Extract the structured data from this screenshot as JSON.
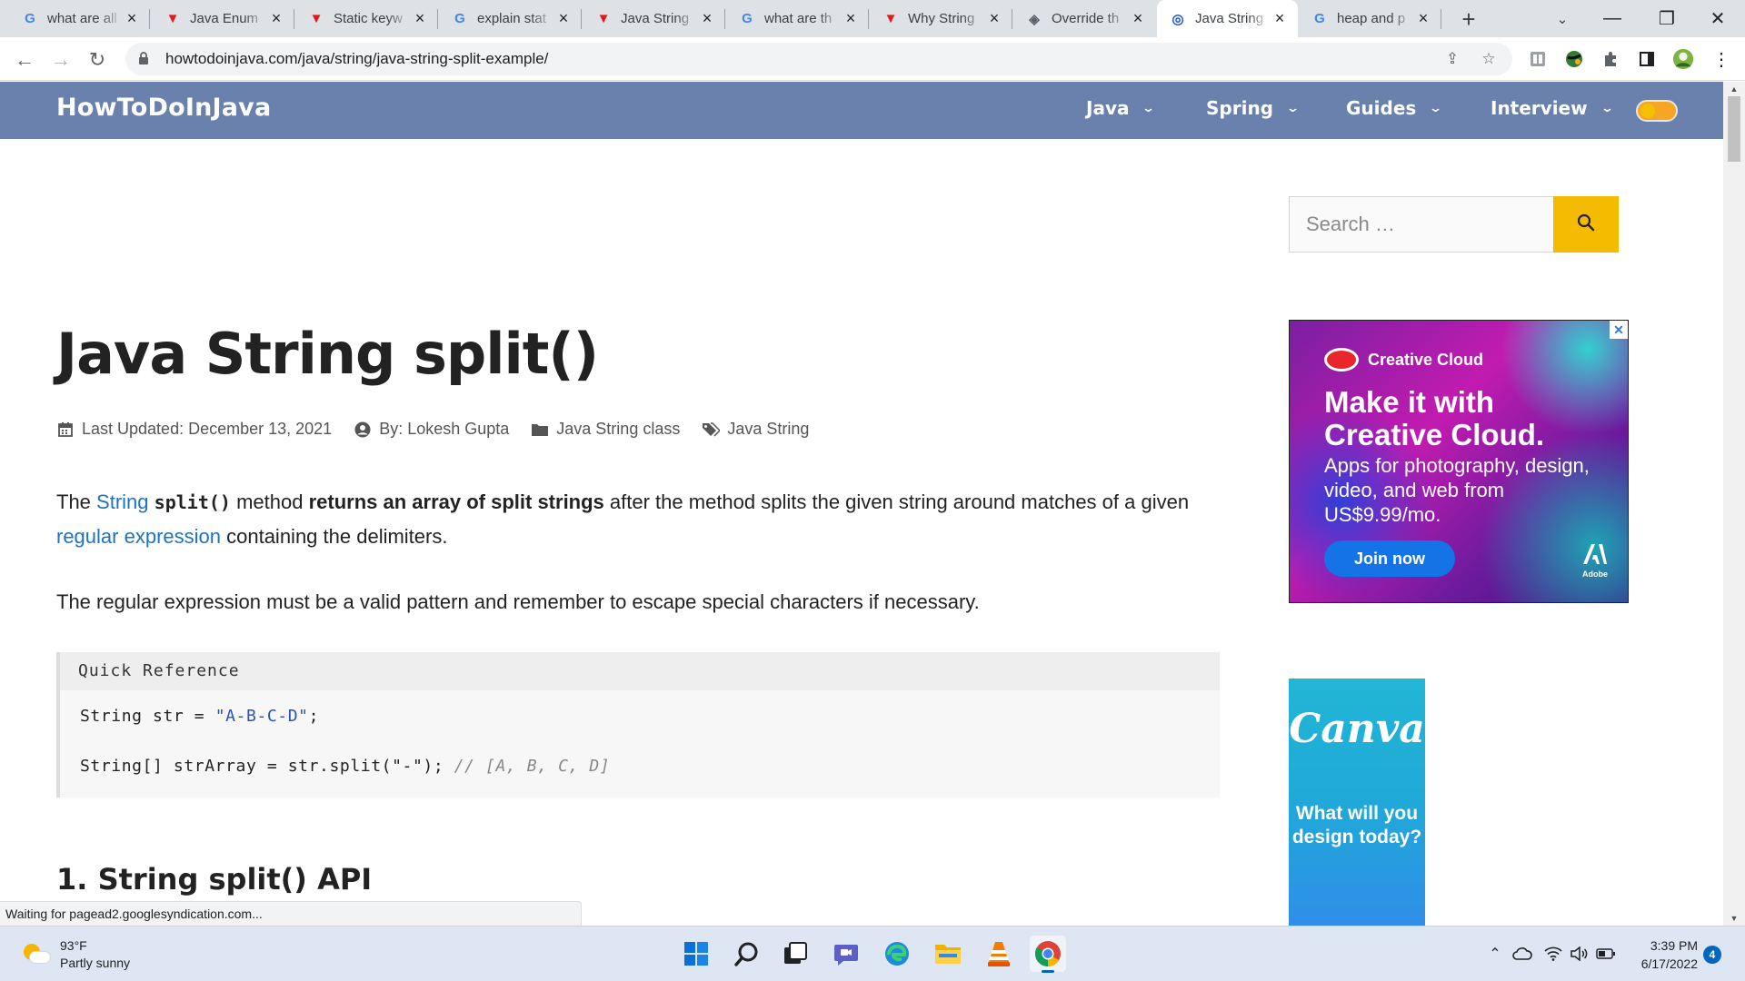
{
  "browser": {
    "tabs": [
      {
        "label": "what are all",
        "favicon": "google-icon",
        "active": false
      },
      {
        "label": "Java Enum",
        "favicon": "vivaldi-v-icon",
        "active": false
      },
      {
        "label": "Static keyw",
        "favicon": "vivaldi-v-icon",
        "active": false
      },
      {
        "label": "explain stat",
        "favicon": "google-icon",
        "active": false
      },
      {
        "label": "Java String",
        "favicon": "vivaldi-v-icon",
        "active": false
      },
      {
        "label": "what are th",
        "favicon": "google-icon",
        "active": false
      },
      {
        "label": "Why String",
        "favicon": "vivaldi-v-icon",
        "active": false
      },
      {
        "label": "Override th",
        "favicon": "diamond-icon",
        "active": false
      },
      {
        "label": "Java String",
        "favicon": "howtodoinjava-icon",
        "active": true
      },
      {
        "label": "heap and p",
        "favicon": "google-icon",
        "active": false
      }
    ],
    "new_tab": "+",
    "url": "howtodoinjava.com/java/string/java-string-split-example/"
  },
  "site": {
    "title": "HowToDoInJava",
    "menu": [
      {
        "label": "Java"
      },
      {
        "label": "Spring"
      },
      {
        "label": "Guides"
      },
      {
        "label": "Interview"
      }
    ]
  },
  "article": {
    "title": "Java String split()",
    "meta": {
      "updated": "Last Updated: December 13, 2021",
      "author": "By: Lokesh Gupta",
      "category": "Java String class",
      "tag": "Java String"
    },
    "intro": {
      "the": "The",
      "string_link": "String",
      "code": "split()",
      "method": "method",
      "bold": "returns an array of split strings",
      "rest": "after the method splits the given string around matches of a given",
      "regex_link": "regular expression",
      "end": "containing the delimiters."
    },
    "para2": "The regular expression must be a valid pattern and remember to escape special characters if necessary.",
    "quick_reference": {
      "heading": "Quick Reference",
      "line1_pre": "String str = ",
      "line1_str": "\"A-B-C-D\"",
      "line1_post": ";",
      "line2_pre": "String[] strArray = str.split(\"-\"); ",
      "line2_comment": "// [A, B, C, D]"
    },
    "section_heading": "1. String split() API"
  },
  "sidebar": {
    "search_placeholder": "Search …",
    "ad_creative_cloud": {
      "brand": "Creative Cloud",
      "headline": "Make it with Creative Cloud.",
      "sub": "Apps for photography, design, video, and web from US$9.99/mo.",
      "button": "Join now",
      "adobe": "Adobe"
    },
    "ad_canva": {
      "logo": "Canva",
      "text": "What will you design today?"
    }
  },
  "status_bar": "Waiting for pagead2.googlesyndication.com...",
  "taskbar": {
    "weather_temp": "93°F",
    "weather_desc": "Partly sunny",
    "time": "3:39 PM",
    "date": "6/17/2022",
    "notifications": "4"
  },
  "colors": {
    "site_header": "#6a80ad",
    "link": "#1e73be",
    "search_button": "#f5bb00",
    "chrome_frame": "#dee1e6"
  }
}
